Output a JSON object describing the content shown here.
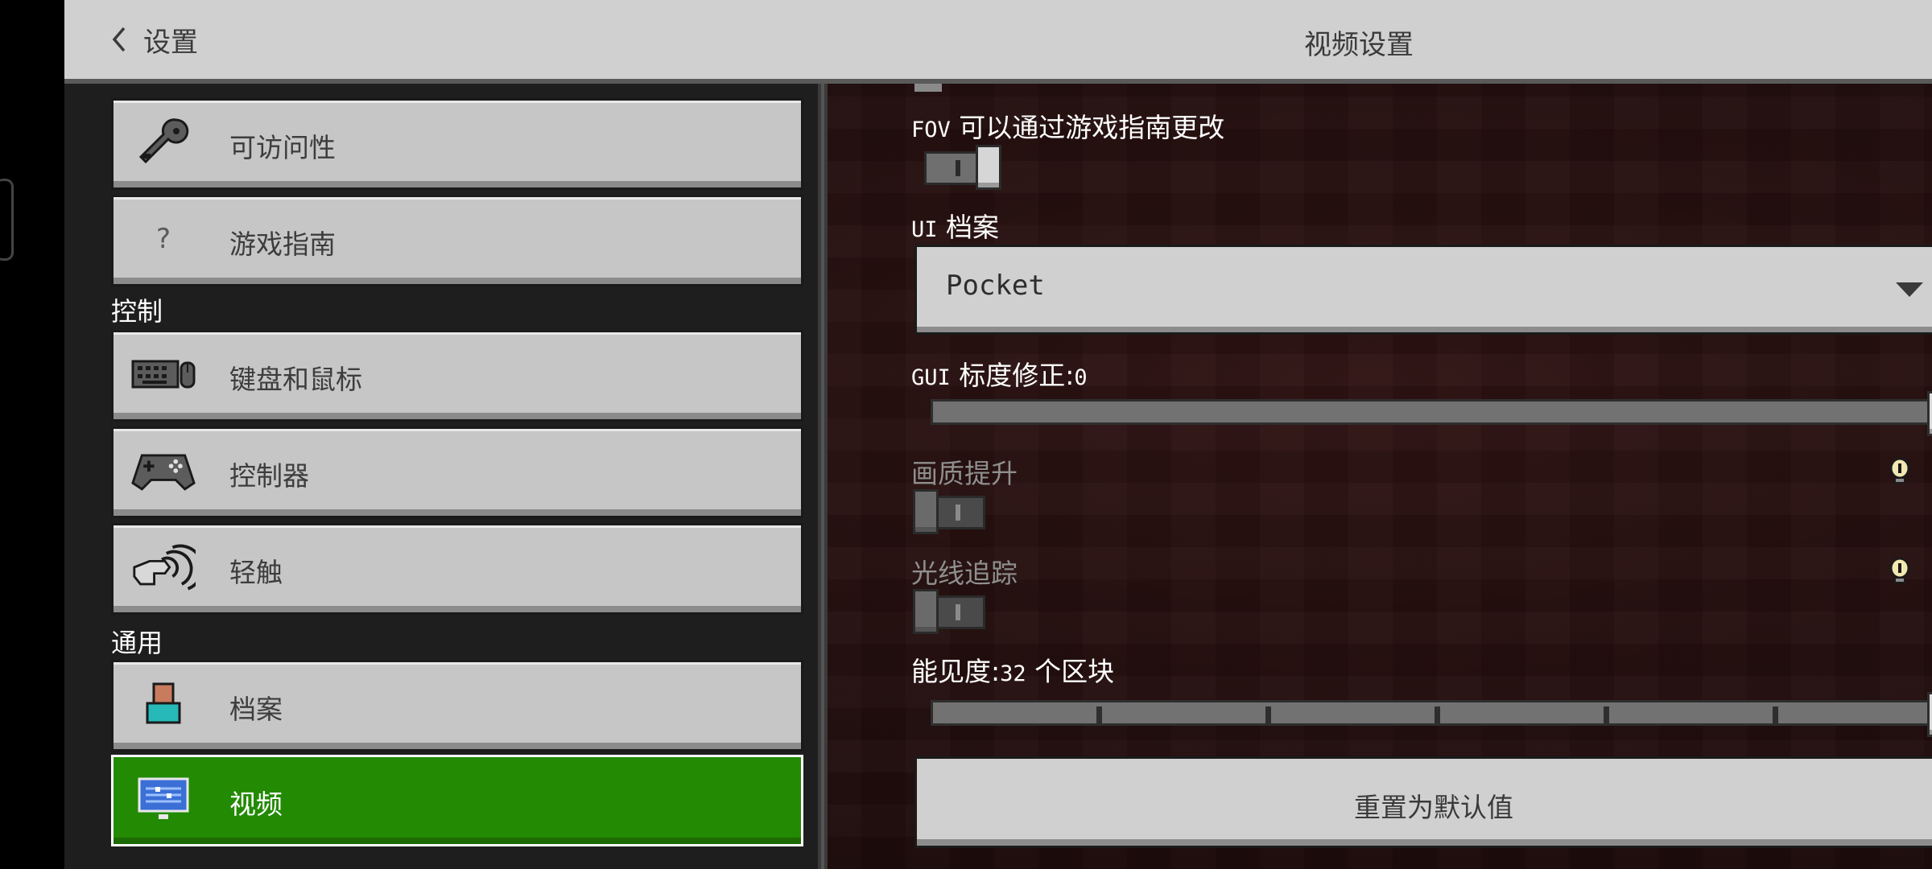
{
  "header": {
    "back_label": "设置",
    "title": "视频设置"
  },
  "sidebar": {
    "items": [
      {
        "label": "可访问性",
        "icon": "key-icon"
      },
      {
        "label": "游戏指南",
        "icon": "question-icon",
        "glyph": "?"
      },
      {
        "label": "键盘和鼠标",
        "icon": "keyboard-mouse-icon"
      },
      {
        "label": "控制器",
        "icon": "gamepad-icon"
      },
      {
        "label": "轻触",
        "icon": "touch-icon"
      },
      {
        "label": "档案",
        "icon": "profile-icon"
      },
      {
        "label": "视频",
        "icon": "monitor-icon",
        "active": true
      }
    ],
    "sections": {
      "controls": "控制",
      "general": "通用"
    }
  },
  "settings": {
    "fov": {
      "label_prefix": "FOV",
      "label": "可以通过游戏指南更改",
      "on": true
    },
    "ui_profile": {
      "label_prefix": "UI",
      "label": "档案",
      "value": "Pocket"
    },
    "gui_scale": {
      "label_prefix": "GUI",
      "label": "标度修正:",
      "value_text": "0",
      "value": 0,
      "min": -1,
      "max": 0
    },
    "upscaling": {
      "label": "画质提升",
      "on": false,
      "disabled": true,
      "info_icon": "lightbulb-icon"
    },
    "raytracing": {
      "label": "光线追踪",
      "on": false,
      "disabled": true,
      "info_icon": "lightbulb-icon"
    },
    "render_distance": {
      "label": "能见度:",
      "value_text": "32",
      "unit": "个区块",
      "value": 32,
      "min": 0,
      "max": 32
    },
    "reset_label": "重置为默认值"
  },
  "colors": {
    "active_green": "#238a04",
    "panel_gray": "#c6c6c6",
    "topbar": "#d0d0d0"
  }
}
